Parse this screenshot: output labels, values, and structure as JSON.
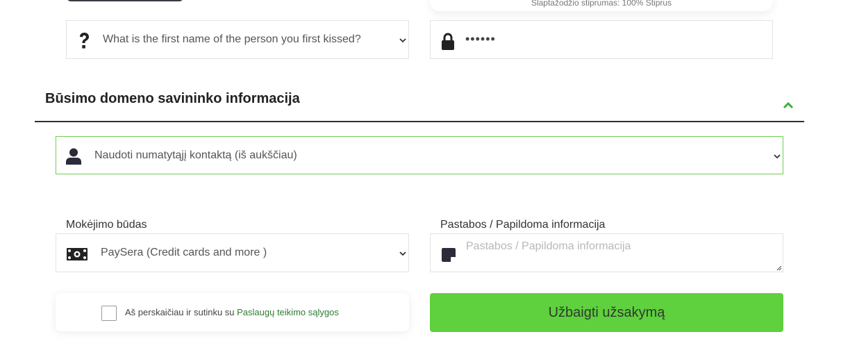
{
  "password_strength_text": "Slaptažodžio stiprumas: 100% Stiprus",
  "security_question": {
    "value": "What is the first name of the person you first kissed?",
    "icon": "question-icon"
  },
  "security_answer": {
    "value": "••••••",
    "icon": "lock-icon"
  },
  "owner_section": {
    "title": "Būsimo domeno savininko informacija",
    "collapse_icon": "chevron-up-icon",
    "accent_color": "#3cb043"
  },
  "contact_select": {
    "value": "Naudoti numatytąjį kontaktą (iš aukščiau)",
    "icon": "user-icon",
    "border_color": "#6fcf4f"
  },
  "payment": {
    "label": "Mokėjimo būdas",
    "value": "PaySera (Credit cards and more )",
    "icon": "money-bill-icon"
  },
  "notes": {
    "label": "Pastabos / Papildoma informacija",
    "placeholder": "Pastabos / Papildoma informacija",
    "icon": "sticky-note-icon"
  },
  "terms": {
    "text": "Aš perskaičiau ir sutinku su",
    "link_text": "Paslaugų teikimo sąlygos",
    "checked": false
  },
  "submit": {
    "label": "Užbaigti užsakymą",
    "color": "#5fd03e"
  }
}
